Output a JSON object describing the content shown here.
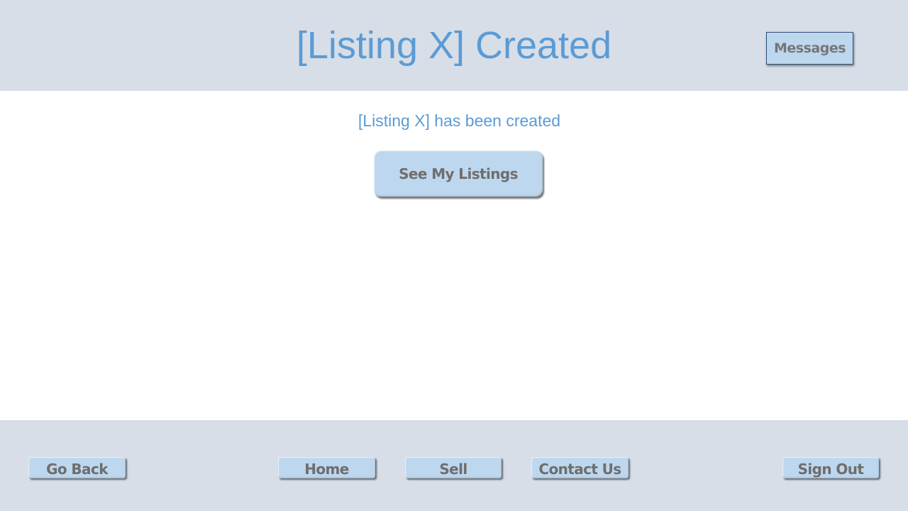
{
  "header": {
    "title": "[Listing X] Created",
    "messages_label": "Messages"
  },
  "main": {
    "confirmation_text": "[Listing X] has been created",
    "see_listings_label": "See My Listings"
  },
  "footer": {
    "go_back_label": "Go Back",
    "home_label": "Home",
    "sell_label": "Sell",
    "contact_label": "Contact Us",
    "sign_out_label": "Sign Out"
  },
  "colors": {
    "band_background": "#d7dee7",
    "title_blue": "#5b9bd5",
    "button_fill": "#bdd7ee",
    "button_text": "#6e6e6e"
  }
}
